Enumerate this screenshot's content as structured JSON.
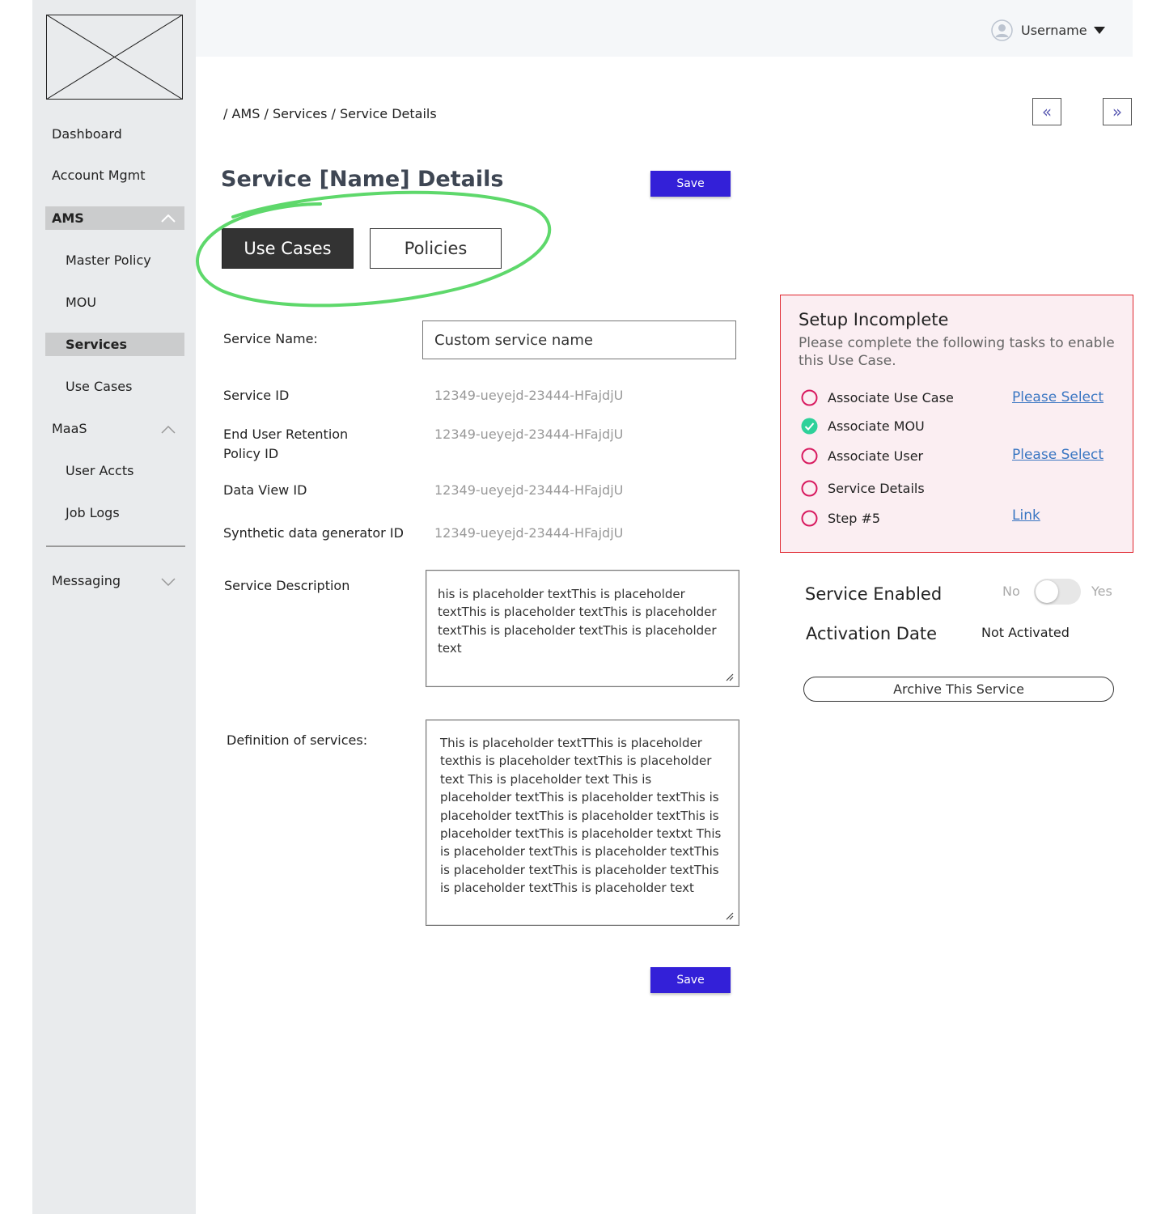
{
  "sidebar": {
    "items": [
      {
        "label": "Dashboard"
      },
      {
        "label": "Account Mgmt"
      },
      {
        "label": "AMS"
      },
      {
        "label": "Master Policy"
      },
      {
        "label": "MOU"
      },
      {
        "label": "Services"
      },
      {
        "label": "Use Cases"
      },
      {
        "label": "MaaS"
      },
      {
        "label": "User Accts"
      },
      {
        "label": "Job Logs"
      },
      {
        "label": "Messaging"
      }
    ]
  },
  "header": {
    "username": "Username"
  },
  "breadcrumb": "/ AMS / Services / Service Details",
  "page": {
    "title": "Service [Name] Details",
    "save_label": "Save",
    "tabs": [
      {
        "label": "Use Cases"
      },
      {
        "label": "Policies"
      }
    ]
  },
  "form": {
    "service_name_label": "Service Name:",
    "service_name_value": "Custom service name",
    "service_id_label": "Service ID",
    "service_id_value": "12349-ueyejd-23444-HFajdjU",
    "retention_label": "End User Retention Policy ID",
    "retention_value": "12349-ueyejd-23444-HFajdjU",
    "data_view_label": "Data View ID",
    "data_view_value": "12349-ueyejd-23444-HFajdjU",
    "synthetic_label": "Synthetic data generator ID",
    "synthetic_value": "12349-ueyejd-23444-HFajdjU",
    "description_label": "Service Description",
    "description_value": "his is placeholder textThis is placeholder textThis is placeholder textThis is placeholder textThis is placeholder textThis is placeholder text",
    "definition_label": "Definition of services:",
    "definition_value": "This is placeholder textTThis is placeholder texthis is placeholder textThis is placeholder text This is placeholder text This is placeholder textThis is placeholder textThis is placeholder textThis is placeholder textThis is placeholder textThis is placeholder textxt This is placeholder textThis is placeholder textThis is placeholder textThis is placeholder textThis is placeholder textThis is placeholder text"
  },
  "setup": {
    "title": "Setup Incomplete",
    "description": "Please complete the following tasks to enable this Use Case.",
    "steps": [
      {
        "label": "Associate Use Case",
        "done": false,
        "link": "Please Select"
      },
      {
        "label": "Associate MOU",
        "done": true,
        "link": ""
      },
      {
        "label": "Associate User",
        "done": false,
        "link": "Please Select"
      },
      {
        "label": "Service Details",
        "done": false,
        "link": ""
      },
      {
        "label": "Step #5",
        "done": false,
        "link": "Link"
      }
    ]
  },
  "status": {
    "enabled_label": "Service Enabled",
    "toggle_off": "No",
    "toggle_on": "Yes",
    "enabled": false,
    "activation_label": "Activation Date",
    "activation_value": "Not Activated",
    "archive_label": "Archive This Service"
  },
  "colors": {
    "primary": "#3320d8",
    "sidebar_bg": "#e9ebed",
    "highlight_ring": "#5ed86b",
    "alert_border": "#e0242d",
    "alert_bg": "#fbeef2",
    "incomplete": "#d81b60",
    "complete": "#2ed19a",
    "link": "#3a76c2"
  }
}
